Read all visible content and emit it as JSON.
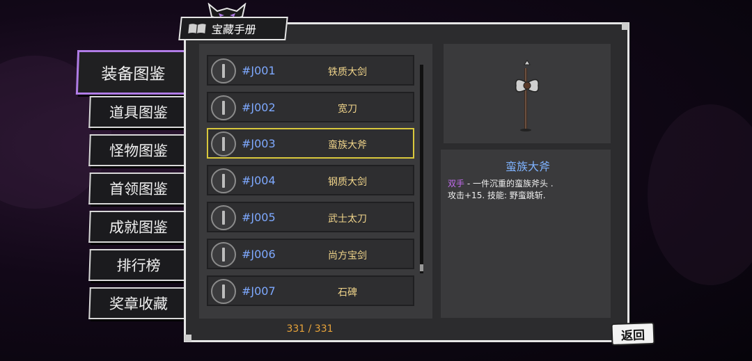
{
  "header": {
    "title": "宝藏手册"
  },
  "tabs": [
    {
      "label": "装备图鉴",
      "active": true
    },
    {
      "label": "道具图鉴"
    },
    {
      "label": "怪物图鉴"
    },
    {
      "label": "首领图鉴"
    },
    {
      "label": "成就图鉴"
    },
    {
      "label": "排行榜"
    },
    {
      "label": "奖章收藏"
    }
  ],
  "items": [
    {
      "code": "#J001",
      "name": "铁质大剑"
    },
    {
      "code": "#J002",
      "name": "宽刀"
    },
    {
      "code": "#J003",
      "name": "蛮族大斧",
      "selected": true
    },
    {
      "code": "#J004",
      "name": "钢质大剑"
    },
    {
      "code": "#J005",
      "name": "武士太刀"
    },
    {
      "code": "#J006",
      "name": "尚方宝剑"
    },
    {
      "code": "#J007",
      "name": "石碑"
    }
  ],
  "counter": "331 / 331",
  "detail": {
    "title": "蛮族大斧",
    "type": "双手",
    "line1_rest": " - 一件沉重的蛮族斧头 .",
    "line2": "攻击+15. 技能: 野蛮跳斩."
  },
  "back_label": "返回",
  "colors": {
    "accent": "#b07ce6",
    "selected": "#d9c83c",
    "code": "#7ea9ff",
    "name": "#f0d48a",
    "counter": "#e8a43a"
  }
}
